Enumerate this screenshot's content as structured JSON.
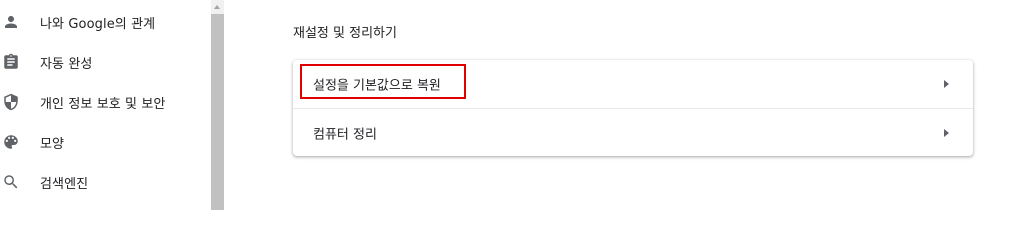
{
  "sidebar": {
    "items": [
      {
        "label": "나와 Google의 관계",
        "icon": "person-icon"
      },
      {
        "label": "자동 완성",
        "icon": "clipboard-icon"
      },
      {
        "label": "개인 정보 보호 및 보안",
        "icon": "shield-icon"
      },
      {
        "label": "모양",
        "icon": "palette-icon"
      },
      {
        "label": "검색엔진",
        "icon": "search-icon"
      }
    ]
  },
  "main": {
    "section_title": "재설정 및 정리하기",
    "rows": [
      {
        "label": "설정을 기본값으로 복원",
        "highlighted": true
      },
      {
        "label": "컴퓨터 정리",
        "highlighted": false
      }
    ]
  },
  "colors": {
    "highlight": "#e00000",
    "icon": "#5f6368",
    "text": "#202124"
  }
}
